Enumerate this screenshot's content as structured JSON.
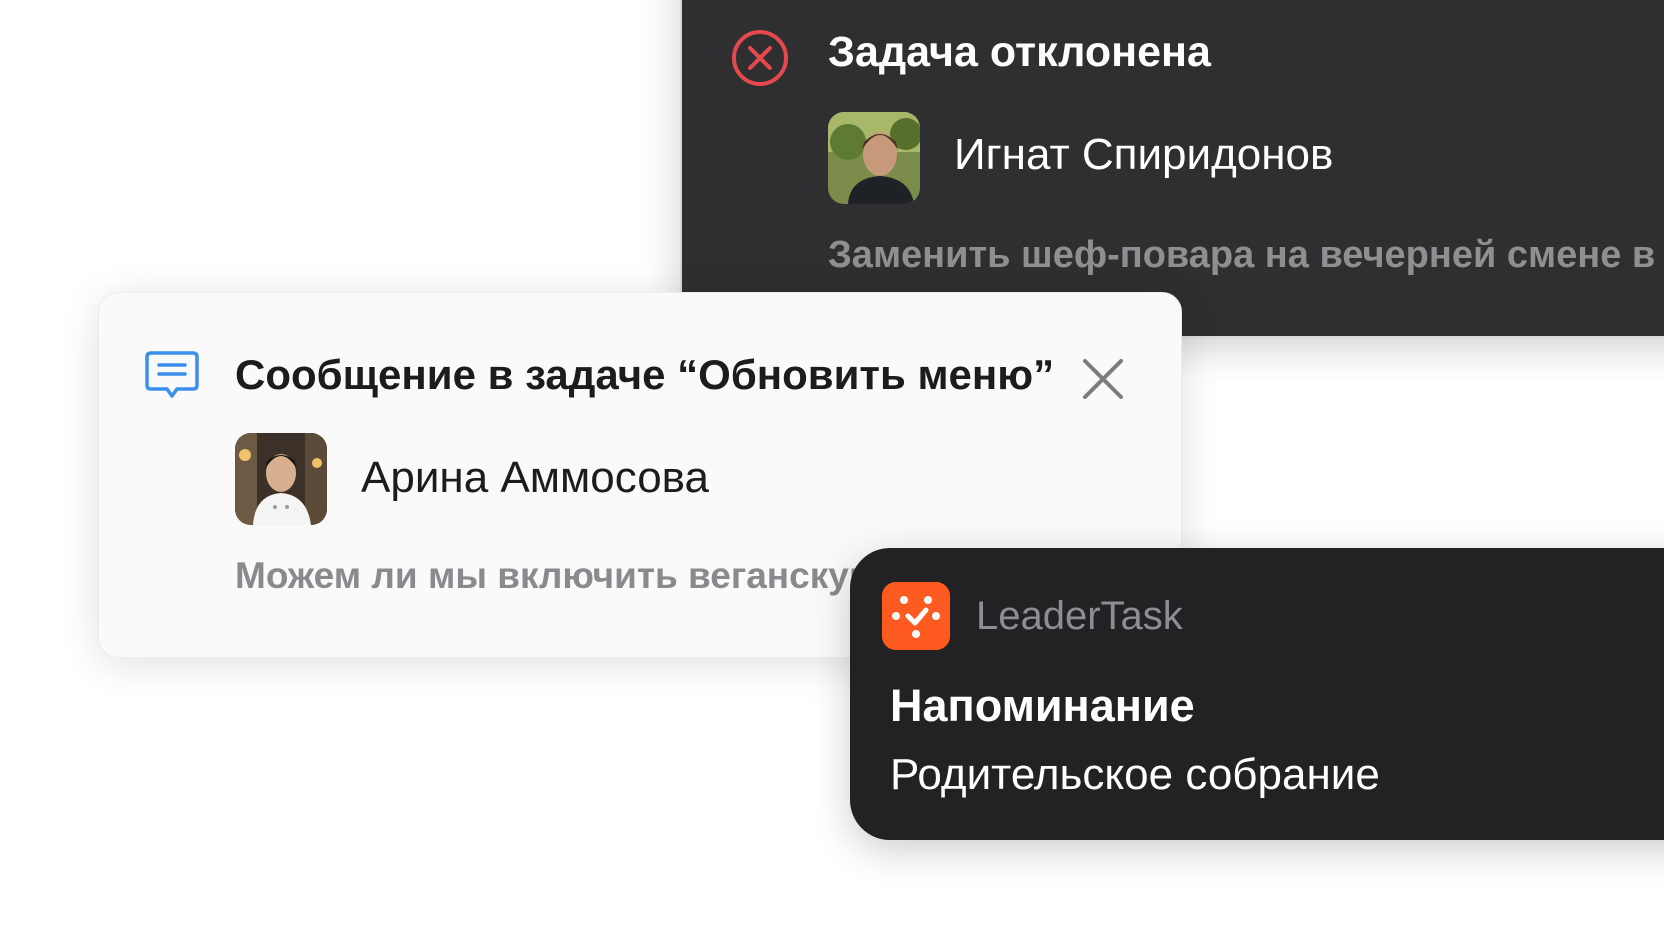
{
  "rejected_notification": {
    "title": "Задача отклонена",
    "user_name": "Игнат Спиридонов",
    "task_text": "Заменить шеф-повара на вечерней смене в р",
    "status_icon": "close-circle-icon",
    "accent_color": "#e5484d"
  },
  "message_notification": {
    "title": "Сообщение в задаче “Обновить меню”",
    "user_name": "Арина Аммосова",
    "message_text": "Можем ли мы включить веганскую пасту?",
    "message_icon": "chat-bubble-icon",
    "close_icon": "close-icon",
    "accent_color": "#3b8eea"
  },
  "reminder_notification": {
    "app_name": "LeaderTask",
    "app_icon": "leadertask-logo-icon",
    "title": "Напоминание",
    "text": "Родительское собрание",
    "brand_color": "#ff5a1f"
  }
}
